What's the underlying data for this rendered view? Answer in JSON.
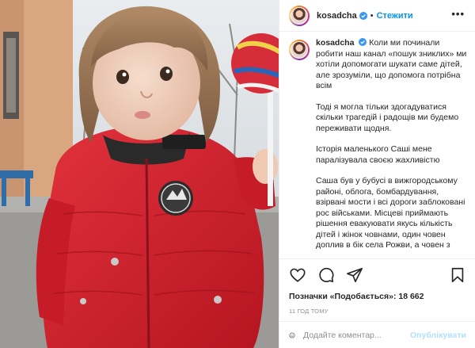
{
  "post": {
    "username": "kosadcha",
    "follow_label": "Стежити",
    "more_label": "•••",
    "caption": {
      "username": "kosadcha",
      "paragraphs": [
        "Коли ми починали робити наш канал «пошук зниклих» ми хотіли допомогати шукати саме дітей, але зрозуміли, що допомога потрібна всім",
        "Тоді я могла тільки здогадуватися скільки трагедій і радощів ми будемо переживати щодня.",
        "Історія маленького Саші мене паралізувала своєю жахливістю",
        "Саша був у бубусі в вижгородському районі, облога, бомбардування, взірвані мости і всі дороги заблоковані рос військами. Місцеві приймають рішення евакуювати якусь кількість дітей і жінок човнами, один човен доплив в бік села Рожви, а човен з"
      ]
    },
    "likes": "Позначки «Подобається»: 18 662",
    "time": "11 год тому",
    "comment_placeholder": "Додайте коментар...",
    "publish_label": "Опублікувати"
  },
  "icons": {
    "header": [
      "avatar",
      "verified-badge-icon",
      "more-options-icon"
    ],
    "actions": [
      "heart-icon",
      "comment-icon",
      "share-icon",
      "bookmark-icon"
    ],
    "comment": [
      "smiley-icon"
    ]
  },
  "colors": {
    "accent": "#0095f6",
    "publish_disabled": "#b2dffc",
    "text": "#262626",
    "secondary_text": "#8e8e8e",
    "jacket": "#d41f2c"
  }
}
